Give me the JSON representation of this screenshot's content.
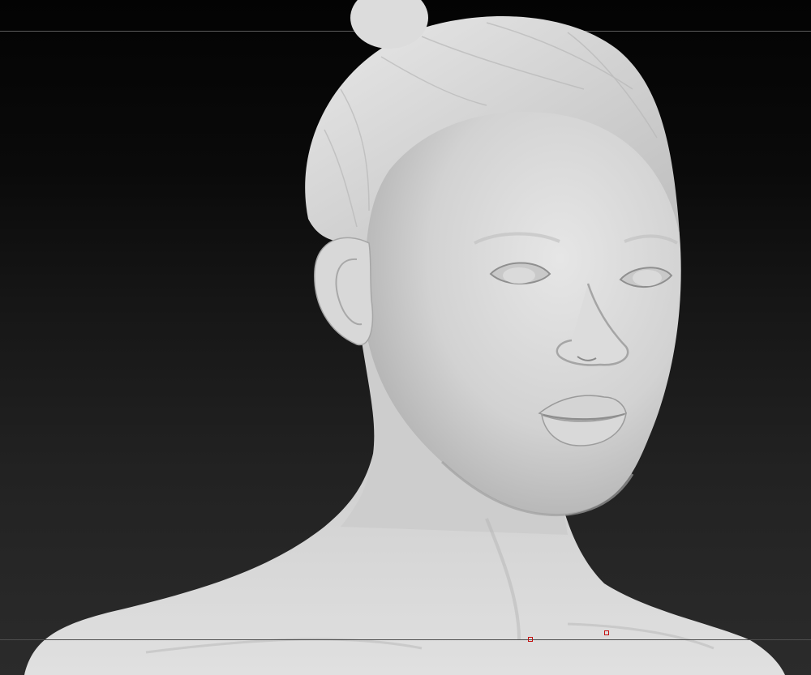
{
  "viewport": {
    "background_top_color": "#030303",
    "background_bottom_color": "#2b2b2b",
    "guide_line_color": "#5a5a5a",
    "model_color": "#d6d6d6",
    "marker_color": "#c41010"
  },
  "scene": {
    "model_icon": "female-head-bust-sculpt-icon",
    "marker_count": 2
  }
}
